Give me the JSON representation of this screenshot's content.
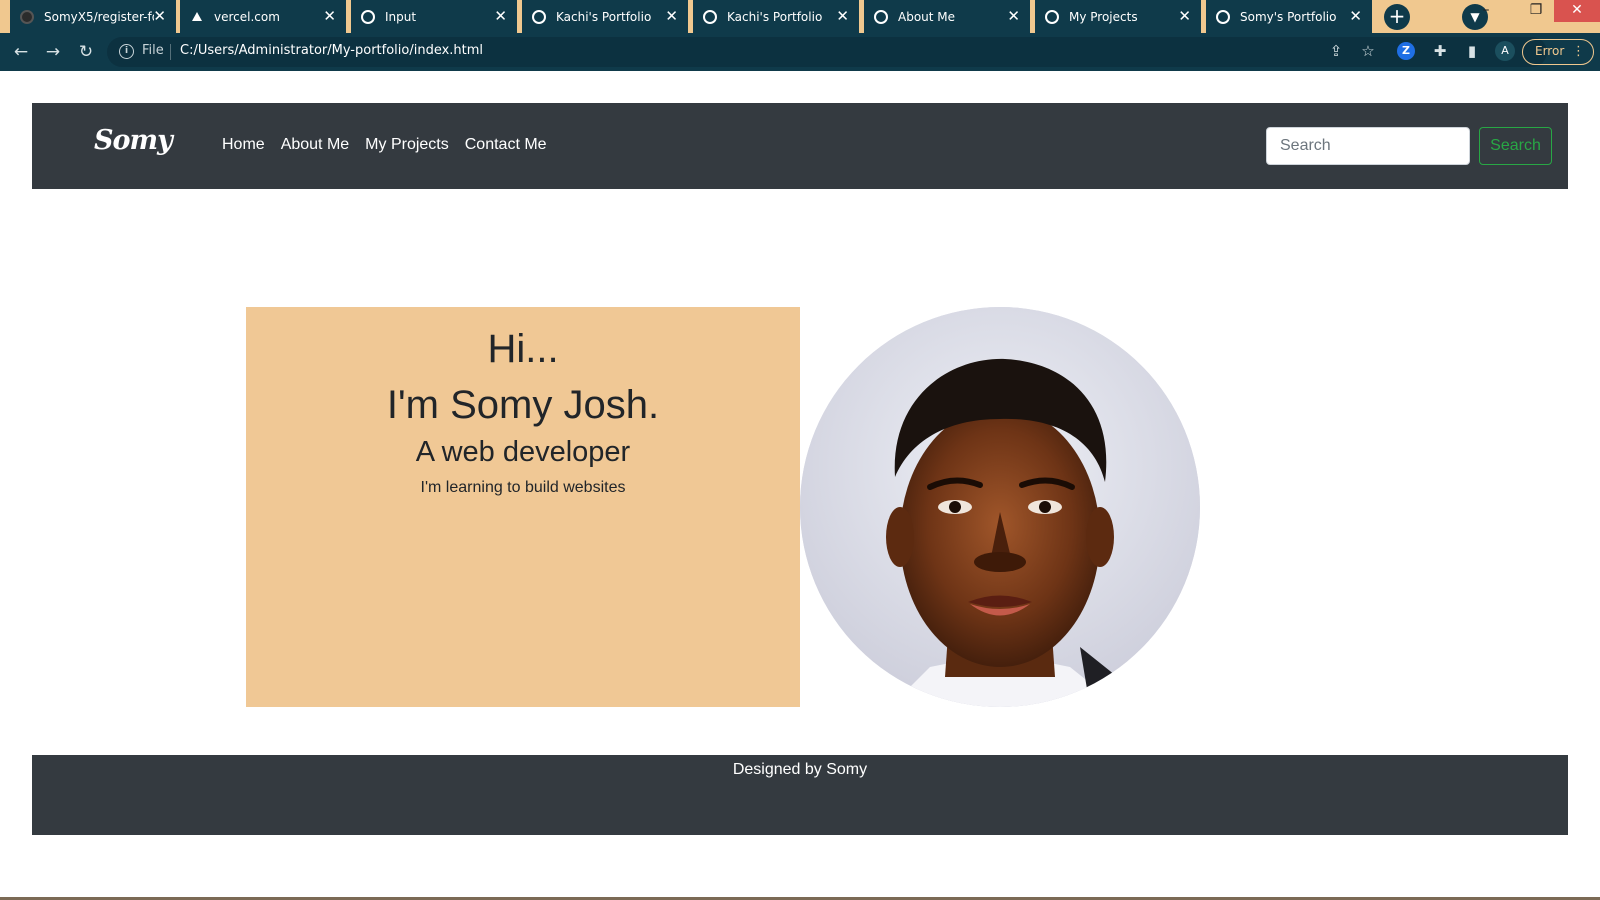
{
  "browser": {
    "tabs": [
      {
        "title": "SomyX5/register-for",
        "icon": "github-icon"
      },
      {
        "title": "vercel.com",
        "icon": "vercel-icon"
      },
      {
        "title": "Input",
        "icon": "globe-icon"
      },
      {
        "title": "Kachi's Portfolio",
        "icon": "globe-icon"
      },
      {
        "title": "Kachi's Portfolio",
        "icon": "globe-icon"
      },
      {
        "title": "About Me",
        "icon": "globe-icon"
      },
      {
        "title": "My Projects",
        "icon": "globe-icon"
      },
      {
        "title": "Somy's Portfolio",
        "icon": "globe-icon",
        "active": true
      }
    ],
    "address": {
      "scheme_label": "File",
      "url": "C:/Users/Administrator/My-portfolio/index.html"
    },
    "profile_initial": "A",
    "error_label": "Error",
    "colors": {
      "frame": "#f0c88f",
      "toolbar": "#0f3a4a"
    }
  },
  "page": {
    "navbar": {
      "brand": "Somy",
      "links": [
        "Home",
        "About Me",
        "My Projects",
        "Contact Me"
      ],
      "search_placeholder": "Search",
      "search_button": "Search"
    },
    "hero": {
      "greeting": "Hi...",
      "name": "I'm Somy Josh.",
      "role": "A web developer",
      "subtitle": "I'm learning to build websites"
    },
    "footer": {
      "text": "Designed by Somy"
    },
    "colors": {
      "navbar": "#343a40",
      "hero_card": "#f0c895",
      "search_button": "#28a745"
    }
  }
}
